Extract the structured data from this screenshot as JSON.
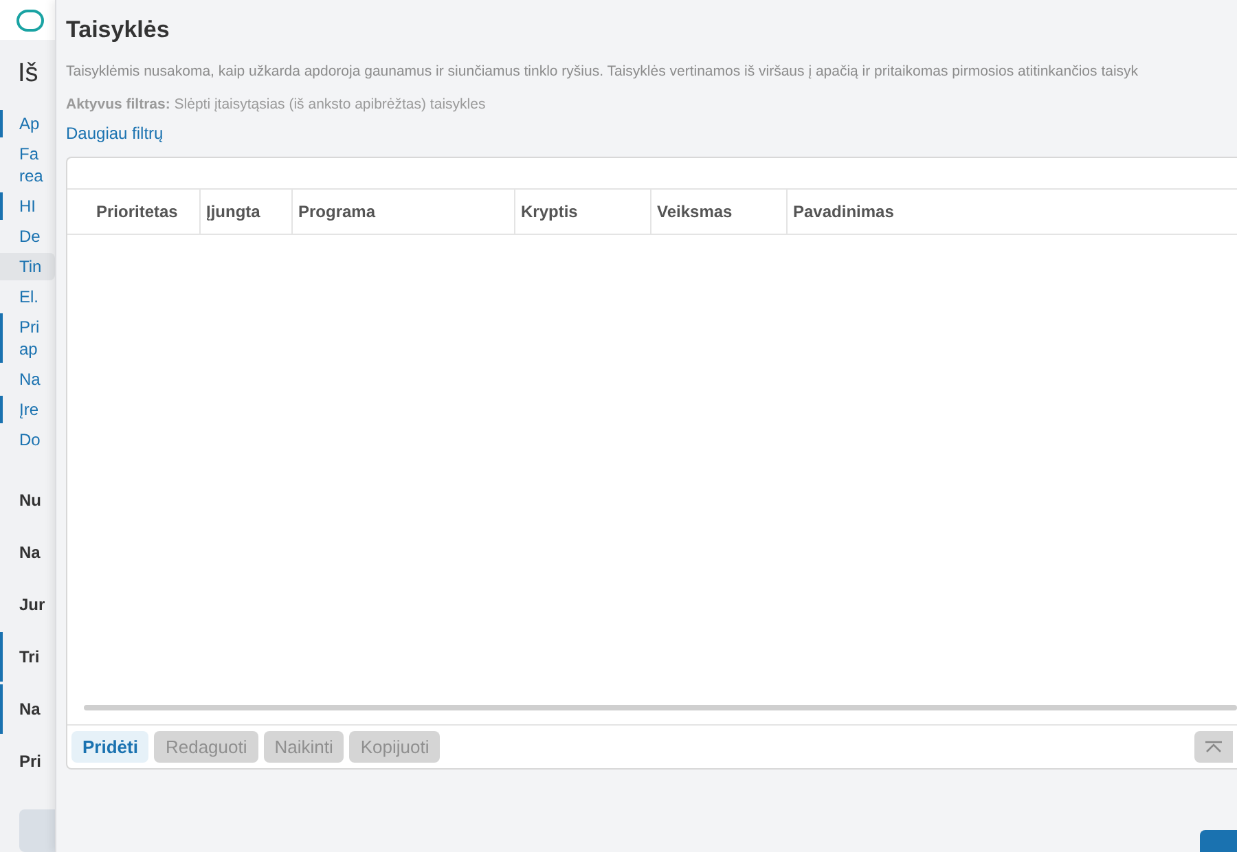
{
  "sidebar": {
    "heading": "Iš",
    "items": [
      {
        "label": "Ap",
        "marked": true,
        "selected": false
      },
      {
        "label": "Fa rea",
        "marked": false,
        "selected": false
      },
      {
        "label": "HI",
        "marked": true,
        "selected": false
      },
      {
        "label": "De",
        "marked": false,
        "selected": false
      },
      {
        "label": "Tin",
        "marked": false,
        "selected": true
      },
      {
        "label": "El.",
        "marked": false,
        "selected": false
      },
      {
        "label": "Pri ap",
        "marked": true,
        "selected": false
      },
      {
        "label": "Na",
        "marked": false,
        "selected": false
      },
      {
        "label": "Įre",
        "marked": true,
        "selected": false
      },
      {
        "label": "Do",
        "marked": false,
        "selected": false
      }
    ],
    "sections": [
      {
        "label": "Nu",
        "marked": false
      },
      {
        "label": "Na",
        "marked": false
      },
      {
        "label": "Jur",
        "marked": false
      },
      {
        "label": "Tri",
        "marked": true
      },
      {
        "label": "Na",
        "marked": true
      },
      {
        "label": "Pri",
        "marked": false
      }
    ]
  },
  "dialog": {
    "title": "Taisyklės",
    "description": "Taisyklėmis nusakoma, kaip užkarda apdoroja gaunamus ir siunčiamus tinklo ryšius. Taisyklės vertinamos iš viršaus į apačią ir pritaikomas pirmosios atitinkančios taisyk",
    "active_filter": "**Aktyvus filtras:** Slėpti įtaisytąsias (iš anksto apibrėžtas) taisykles",
    "more_filters_link": "Daugiau filtrų",
    "table": {
      "columns": [
        "Prioritetas",
        "Įjungta",
        "Programa",
        "Kryptis",
        "Veiksmas",
        "Pavadinimas"
      ]
    },
    "buttons": [
      {
        "label": "Pridėti",
        "disabled": false
      },
      {
        "label": "Redaguoti",
        "disabled": true
      },
      {
        "label": "Naikinti",
        "disabled": true
      },
      {
        "label": "Kopijuoti",
        "disabled": true
      }
    ]
  }
}
